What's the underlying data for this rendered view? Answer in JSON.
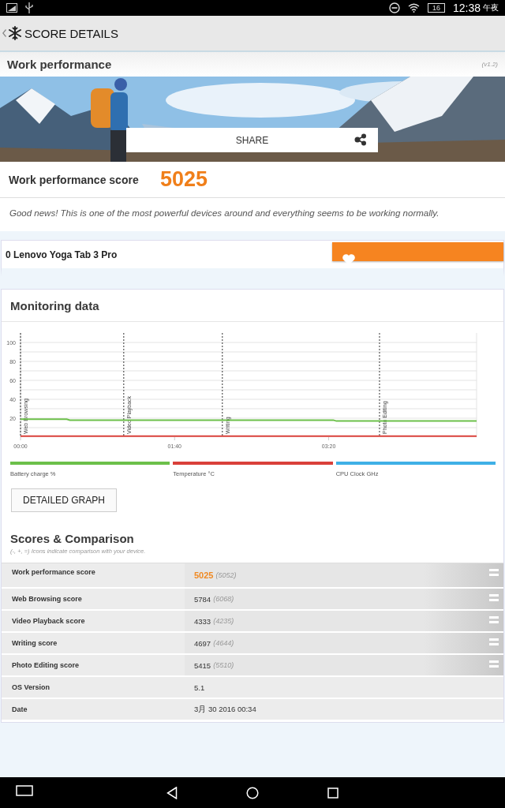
{
  "status_bar": {
    "battery": "16",
    "time": "12:38",
    "period": "午夜"
  },
  "app_bar": {
    "title": "SCORE DETAILS"
  },
  "header": {
    "title": "Work performance",
    "version": "(v1.2)"
  },
  "banner": {
    "kind": "picture",
    "share_label": "SHARE"
  },
  "score": {
    "label": "Work performance score",
    "value": "5025"
  },
  "message": "Good news! This is one of the most powerful devices around and everything seems to be working normally.",
  "device": {
    "name": "0 Lenovo Yoga Tab 3 Pro"
  },
  "monitoring": {
    "title": "Monitoring data",
    "chart_data": {
      "type": "line",
      "grid": true,
      "x": [
        0,
        30,
        32,
        67,
        131,
        203,
        205,
        233,
        296
      ],
      "xlim": [
        0,
        296
      ],
      "ylim": [
        0,
        110
      ],
      "xticks": [
        {
          "value": 0,
          "label": "00:00"
        },
        {
          "value": 100,
          "label": "01:40"
        },
        {
          "value": 200,
          "label": "03:20"
        }
      ],
      "yticks": [
        20,
        40,
        60,
        80,
        100
      ],
      "series": [
        {
          "name": "Battery charge %",
          "color": "#6cc04a",
          "values": [
            19,
            19,
            18,
            18,
            18,
            18,
            17,
            17,
            17
          ]
        },
        {
          "name": "Temperature °C",
          "color": "#d9403a",
          "values": [
            1,
            1,
            1,
            1,
            1,
            1,
            1,
            1,
            1
          ]
        },
        {
          "name": "CPU Clock GHz",
          "color": "#3fb0e6",
          "values": [
            null,
            null,
            null,
            null,
            null,
            null,
            null,
            null,
            null
          ]
        }
      ],
      "ref_lines": [
        {
          "axis": "x",
          "value": 0,
          "label": "Web Browsing"
        },
        {
          "axis": "x",
          "value": 67,
          "label": "Video Playback"
        },
        {
          "axis": "x",
          "value": 131,
          "label": "Writing"
        },
        {
          "axis": "x",
          "value": 233,
          "label": "Photo Editing"
        }
      ]
    },
    "button": "DETAILED GRAPH"
  },
  "scores": {
    "title": "Scores & Comparison",
    "note": "(-, +, =) Icons indicate comparison with your device.",
    "rows": [
      {
        "kind": "score",
        "label": "Work performance score",
        "value": "5025",
        "reference": "(5052)",
        "highlight": true
      },
      {
        "kind": "score",
        "label": "Web Browsing score",
        "value": "5784",
        "reference": "(6068)",
        "highlight": false
      },
      {
        "kind": "score",
        "label": "Video Playback score",
        "value": "4333",
        "reference": "(4235)",
        "highlight": false
      },
      {
        "kind": "score",
        "label": "Writing score",
        "value": "4697",
        "reference": "(4644)",
        "highlight": false
      },
      {
        "kind": "score",
        "label": "Photo Editing score",
        "value": "5415",
        "reference": "(5510)",
        "highlight": false
      },
      {
        "kind": "info",
        "label": "OS Version",
        "value": "5.1"
      },
      {
        "kind": "info",
        "label": "Date",
        "value": "3月 30 2016 00:34"
      }
    ]
  }
}
